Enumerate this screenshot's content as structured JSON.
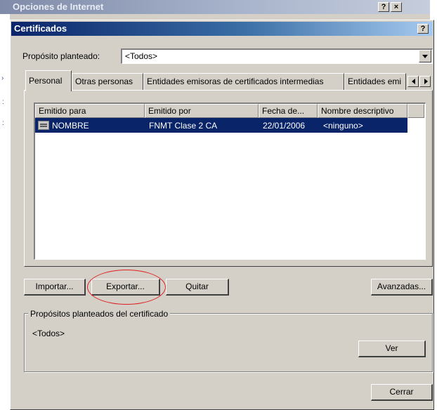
{
  "background_window": {
    "title": "Opciones de Internet",
    "help_button": "?",
    "close_button": "×"
  },
  "dialog": {
    "title": "Certificados",
    "help_button": "?",
    "purpose_label": "Propósito planteado:",
    "purpose_value": "<Todos>",
    "tabs": [
      {
        "label": "Personal",
        "active": true
      },
      {
        "label": "Otras personas",
        "active": false
      },
      {
        "label": "Entidades emisoras de certificados intermedias",
        "active": false
      },
      {
        "label": "Entidades emi",
        "active": false
      }
    ],
    "table": {
      "columns": [
        "Emitido para",
        "Emitido por",
        "Fecha de...",
        "Nombre descriptivo"
      ],
      "rows": [
        [
          "NOMBRE",
          "FNMT Clase 2 CA",
          "22/01/2006",
          "<ninguno>"
        ]
      ]
    },
    "buttons": {
      "import": "Importar...",
      "export": "Exportar...",
      "remove": "Quitar",
      "advanced": "Avanzadas...",
      "view": "Ver",
      "close": "Cerrar"
    },
    "group": {
      "title": "Propósitos planteados del certificado",
      "value": "<Todos>"
    }
  },
  "colors": {
    "dialog_face": "#d4d0c8",
    "active_titlebar": "#0a246a",
    "selection": "#0a246a",
    "annotation_circle": "#e02020"
  }
}
